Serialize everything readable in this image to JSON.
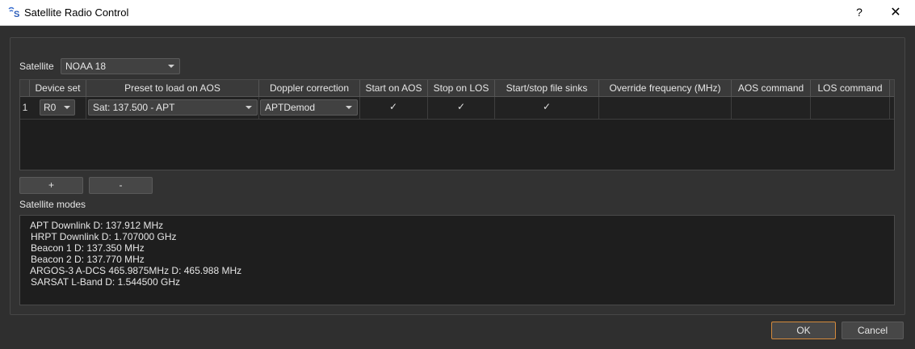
{
  "window": {
    "title": "Satellite Radio Control",
    "help_label": "?",
    "close_label": "✕"
  },
  "satellite": {
    "label": "Satellite",
    "value": "NOAA 18"
  },
  "table": {
    "headers": [
      "Device set",
      "Preset to load on AOS",
      "Doppler correction",
      "Start on AOS",
      "Stop on LOS",
      "Start/stop file sinks",
      "Override frequency (MHz)",
      "AOS command",
      "LOS command"
    ],
    "rows": [
      {
        "index": "1",
        "device_set": "R0",
        "preset": "Sat: 137.500 - APT",
        "doppler": "APTDemod",
        "start_on_aos": true,
        "stop_on_los": true,
        "file_sinks": true,
        "check_mark": "✓",
        "override_frequency": "",
        "aos_command": "",
        "los_command": ""
      }
    ]
  },
  "buttons": {
    "add": "+",
    "remove": "-",
    "ok": "OK",
    "cancel": "Cancel"
  },
  "modes": {
    "label": "Satellite modes",
    "lines": [
      "APT Downlink D: 137.912 MHz",
      "HRPT Downlink D: 1.707000 GHz",
      "Beacon 1 D: 137.350 MHz",
      "Beacon 2 D: 137.770 MHz",
      "ARGOS-3 A-DCS 465.9875MHz D: 465.988 MHz",
      "SARSAT L-Band D: 1.544500 GHz"
    ]
  },
  "colors": {
    "background": "#2f2f2f",
    "table_bg": "#1e1e1e",
    "ok_border": "#d48a3c"
  }
}
